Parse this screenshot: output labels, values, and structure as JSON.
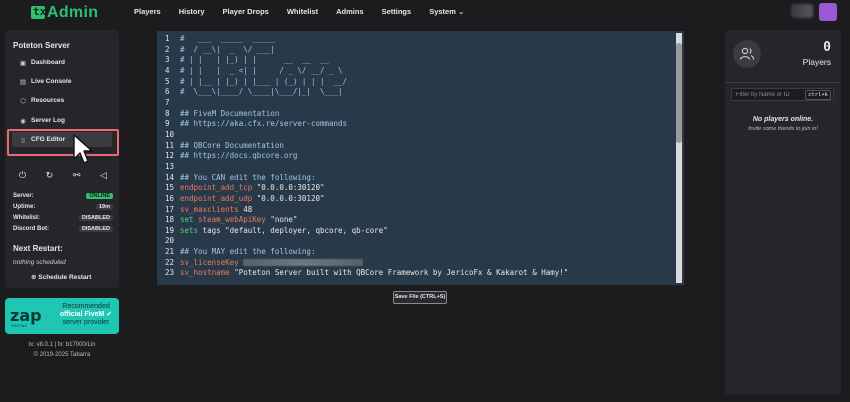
{
  "app": {
    "logo_icon": "tx",
    "logo_text": "Admin"
  },
  "nav": {
    "items": [
      "Players",
      "History",
      "Player Drops",
      "Whitelist",
      "Admins",
      "Settings",
      "System ⌄"
    ]
  },
  "sidebar": {
    "server_name": "Poteton Server",
    "items": [
      {
        "label": "Dashboard",
        "icon": "dashboard-icon"
      },
      {
        "label": "Live Console",
        "icon": "terminal-icon"
      },
      {
        "label": "Resources",
        "icon": "box-icon"
      },
      {
        "label": "Server Log",
        "icon": "eye-icon"
      },
      {
        "label": "CFG Editor",
        "icon": "file-icon"
      }
    ],
    "controls": [
      "power-off-icon",
      "restart-icon",
      "kick-icon",
      "megaphone-icon"
    ],
    "status": [
      {
        "key": "Server:",
        "value": "ONLINE",
        "color": "#2fbf71"
      },
      {
        "key": "Uptime:",
        "value": "19m"
      },
      {
        "key": "Whitelist:",
        "value": "DISABLED"
      },
      {
        "key": "Discord Bot:",
        "value": "DISABLED"
      }
    ],
    "next_restart_title": "Next Restart:",
    "next_restart_value": "nothing scheduled",
    "schedule_button": "Schedule Restart"
  },
  "ad": {
    "logo": "zap",
    "sub": "HOSTING",
    "line1": "Recommended",
    "line2": "official FiveM",
    "line3": "server provider"
  },
  "footer": {
    "version": "tx: v8.0.1 | fx: b17000/Lin",
    "copyright": "© 2019-2025 Tabarra"
  },
  "editor": {
    "lines": [
      {
        "n": "1",
        "parts": [
          [
            "cm",
            "#   ___  _____  _____"
          ]
        ]
      },
      {
        "n": "2",
        "parts": [
          [
            "cm",
            "#  / __\\|  _  \\/ ___|"
          ]
        ]
      },
      {
        "n": "3",
        "parts": [
          [
            "cm",
            "# | |   | |_) | |      __  __  __"
          ]
        ]
      },
      {
        "n": "4",
        "parts": [
          [
            "cm",
            "# | |   |  _ <| |     / _ \\/ __/ _ \\"
          ]
        ]
      },
      {
        "n": "5",
        "parts": [
          [
            "cm",
            "# | |__ | |_) | |___ | (_) | | |  __/"
          ]
        ]
      },
      {
        "n": "6",
        "parts": [
          [
            "cm",
            "#  \\___\\|____/ \\____|\\___/|_|  \\___|"
          ]
        ]
      },
      {
        "n": "7",
        "parts": []
      },
      {
        "n": "8",
        "parts": [
          [
            "cm",
            "## FiveM Documentation"
          ]
        ]
      },
      {
        "n": "9",
        "parts": [
          [
            "cm",
            "## https://aka.cfx.re/server-commands"
          ]
        ]
      },
      {
        "n": "10",
        "parts": []
      },
      {
        "n": "11",
        "parts": [
          [
            "cm",
            "## QBCore Documentation"
          ]
        ]
      },
      {
        "n": "12",
        "parts": [
          [
            "cm",
            "## https://docs.qbcore.org"
          ]
        ]
      },
      {
        "n": "13",
        "parts": []
      },
      {
        "n": "14",
        "parts": [
          [
            "cm",
            "## You CAN edit the following:"
          ]
        ]
      },
      {
        "n": "15",
        "parts": [
          [
            "kw",
            "endpoint_add_tcp "
          ],
          [
            "str",
            "\"0.0.0.0:30120\""
          ]
        ]
      },
      {
        "n": "16",
        "parts": [
          [
            "kw",
            "endpoint_add_udp "
          ],
          [
            "str",
            "\"0.0.0.0:30120\""
          ]
        ]
      },
      {
        "n": "17",
        "parts": [
          [
            "kw",
            "sv_maxclients "
          ],
          [
            "str",
            "48"
          ]
        ]
      },
      {
        "n": "18",
        "parts": [
          [
            "kg",
            "set "
          ],
          [
            "kw",
            "steam_webApiKey "
          ],
          [
            "str",
            "\"none\""
          ]
        ]
      },
      {
        "n": "19",
        "parts": [
          [
            "kg",
            "sets "
          ],
          [
            "str",
            "tags \"default, deployer, qbcore, qb-core\""
          ]
        ]
      },
      {
        "n": "20",
        "parts": []
      },
      {
        "n": "21",
        "parts": [
          [
            "cm",
            "## You MAY edit the following:"
          ]
        ]
      },
      {
        "n": "22",
        "parts": [
          [
            "kw",
            "sv_licenseKey "
          ],
          [
            "blur",
            ""
          ]
        ]
      },
      {
        "n": "23",
        "parts": [
          [
            "kw",
            "sv_hostname "
          ],
          [
            "str",
            "\"Poteton Server built with QBCore Framework by JericoFx & Kakarot & Hamy!\""
          ]
        ]
      }
    ]
  },
  "save_button": "Save File (CTRL+S)",
  "players": {
    "count": "0",
    "label": "Players",
    "filter_placeholder": "Filter by Name or ID",
    "filter_shortcut": "ctrl+k",
    "empty_title": "No players online.",
    "empty_sub": "Invite some friends to join in!"
  }
}
